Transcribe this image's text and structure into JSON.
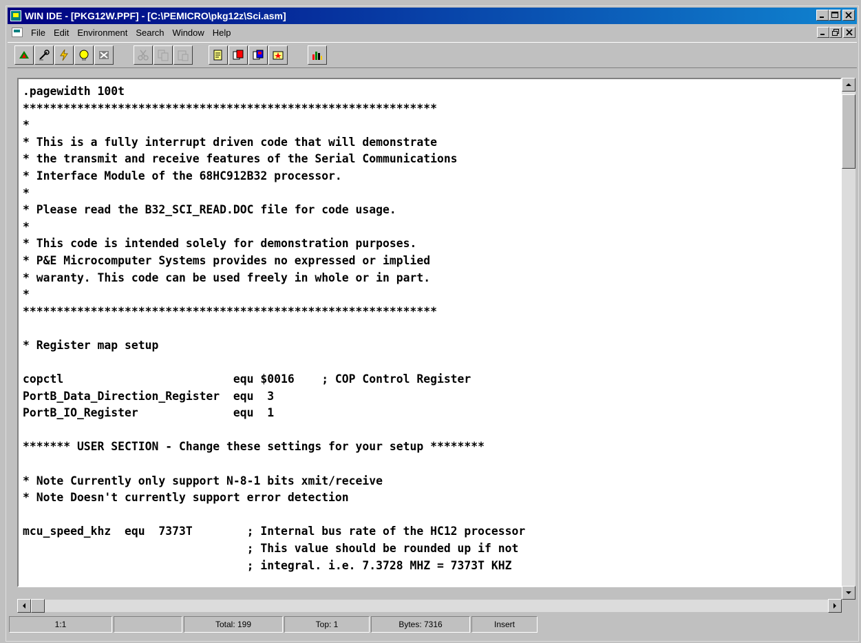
{
  "window": {
    "title": "WIN IDE - [PKG12W.PPF] - [C:\\PEMICRO\\pkg12z\\Sci.asm]",
    "caption_buttons": [
      "minimize-icon",
      "maximize-icon",
      "close-icon"
    ]
  },
  "menu": {
    "items": [
      "File",
      "Edit",
      "Environment",
      "Search",
      "Window",
      "Help"
    ]
  },
  "toolbar": {
    "buttons": [
      "run-icon",
      "build-icon",
      "lightning-icon",
      "lamp-icon",
      "tools-icon",
      "cut-icon",
      "copy-icon",
      "paste-icon",
      "new-file-icon",
      "open-file-icon",
      "save-file-icon",
      "star-icon",
      "chart-icon"
    ]
  },
  "editor": {
    "lines": [
      ".pagewidth 100t",
      "*************************************************************",
      "*",
      "* This is a fully interrupt driven code that will demonstrate",
      "* the transmit and receive features of the Serial Communications",
      "* Interface Module of the 68HC912B32 processor.",
      "*",
      "* Please read the B32_SCI_READ.DOC file for code usage.",
      "*",
      "* This code is intended solely for demonstration purposes.",
      "* P&E Microcomputer Systems provides no expressed or implied",
      "* waranty. This code can be used freely in whole or in part.",
      "*",
      "*************************************************************",
      "",
      "* Register map setup",
      "",
      "copctl                         equ $0016    ; COP Control Register",
      "PortB_Data_Direction_Register  equ  3",
      "PortB_IO_Register              equ  1",
      "",
      "******* USER SECTION - Change these settings for your setup ********",
      "",
      "* Note Currently only support N-8-1 bits xmit/receive",
      "* Note Doesn't currently support error detection",
      "",
      "mcu_speed_khz  equ  7373T        ; Internal bus rate of the HC12 processor",
      "                                 ; This value should be rounded up if not",
      "                                 ; integral. i.e. 7.3728 MHZ = 7373T KHZ"
    ]
  },
  "status": {
    "position": "1:1",
    "empty": "",
    "total": "Total: 199",
    "top": "Top: 1",
    "bytes": "Bytes: 7316",
    "mode": "Insert"
  }
}
